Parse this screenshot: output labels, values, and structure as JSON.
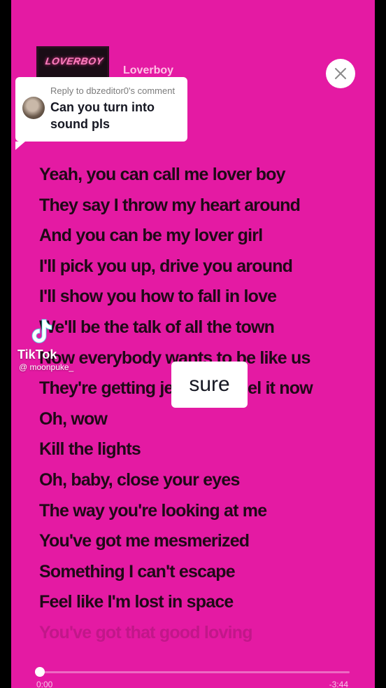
{
  "colors": {
    "background": "#e41aa3",
    "lyrics": "#1f0917",
    "title": "#ffc1e6",
    "bubble": "#ffffff"
  },
  "album": {
    "art_label": "LOVERBOY",
    "title": "Loverboy"
  },
  "close_icon": "close-icon",
  "reply": {
    "meta": "Reply to dbzeditor0's comment",
    "text": "Can you turn into sound pls"
  },
  "lyrics": [
    "Yeah, you can call me lover boy",
    "They say I throw my heart around",
    "And you can be my lover girl",
    "I'll pick you up, drive you around",
    "I'll show you how to fall in love",
    "We'll be the talk of all the town",
    "Now everybody wants to be like us",
    "They're getting jealous, I feel it now",
    "Oh, wow",
    "Kill the lights",
    "Oh, baby, close your eyes",
    "The way you're looking at me",
    "You've got me mesmerized",
    "Something I can't escape",
    "Feel like I'm lost in space",
    "You've got that good loving"
  ],
  "watermark": {
    "name": "TikTok",
    "handle": "@ moonpuke_"
  },
  "caption": "sure",
  "player": {
    "progress": 0.0,
    "elapsed": "0:00",
    "remaining": "-3:44"
  }
}
